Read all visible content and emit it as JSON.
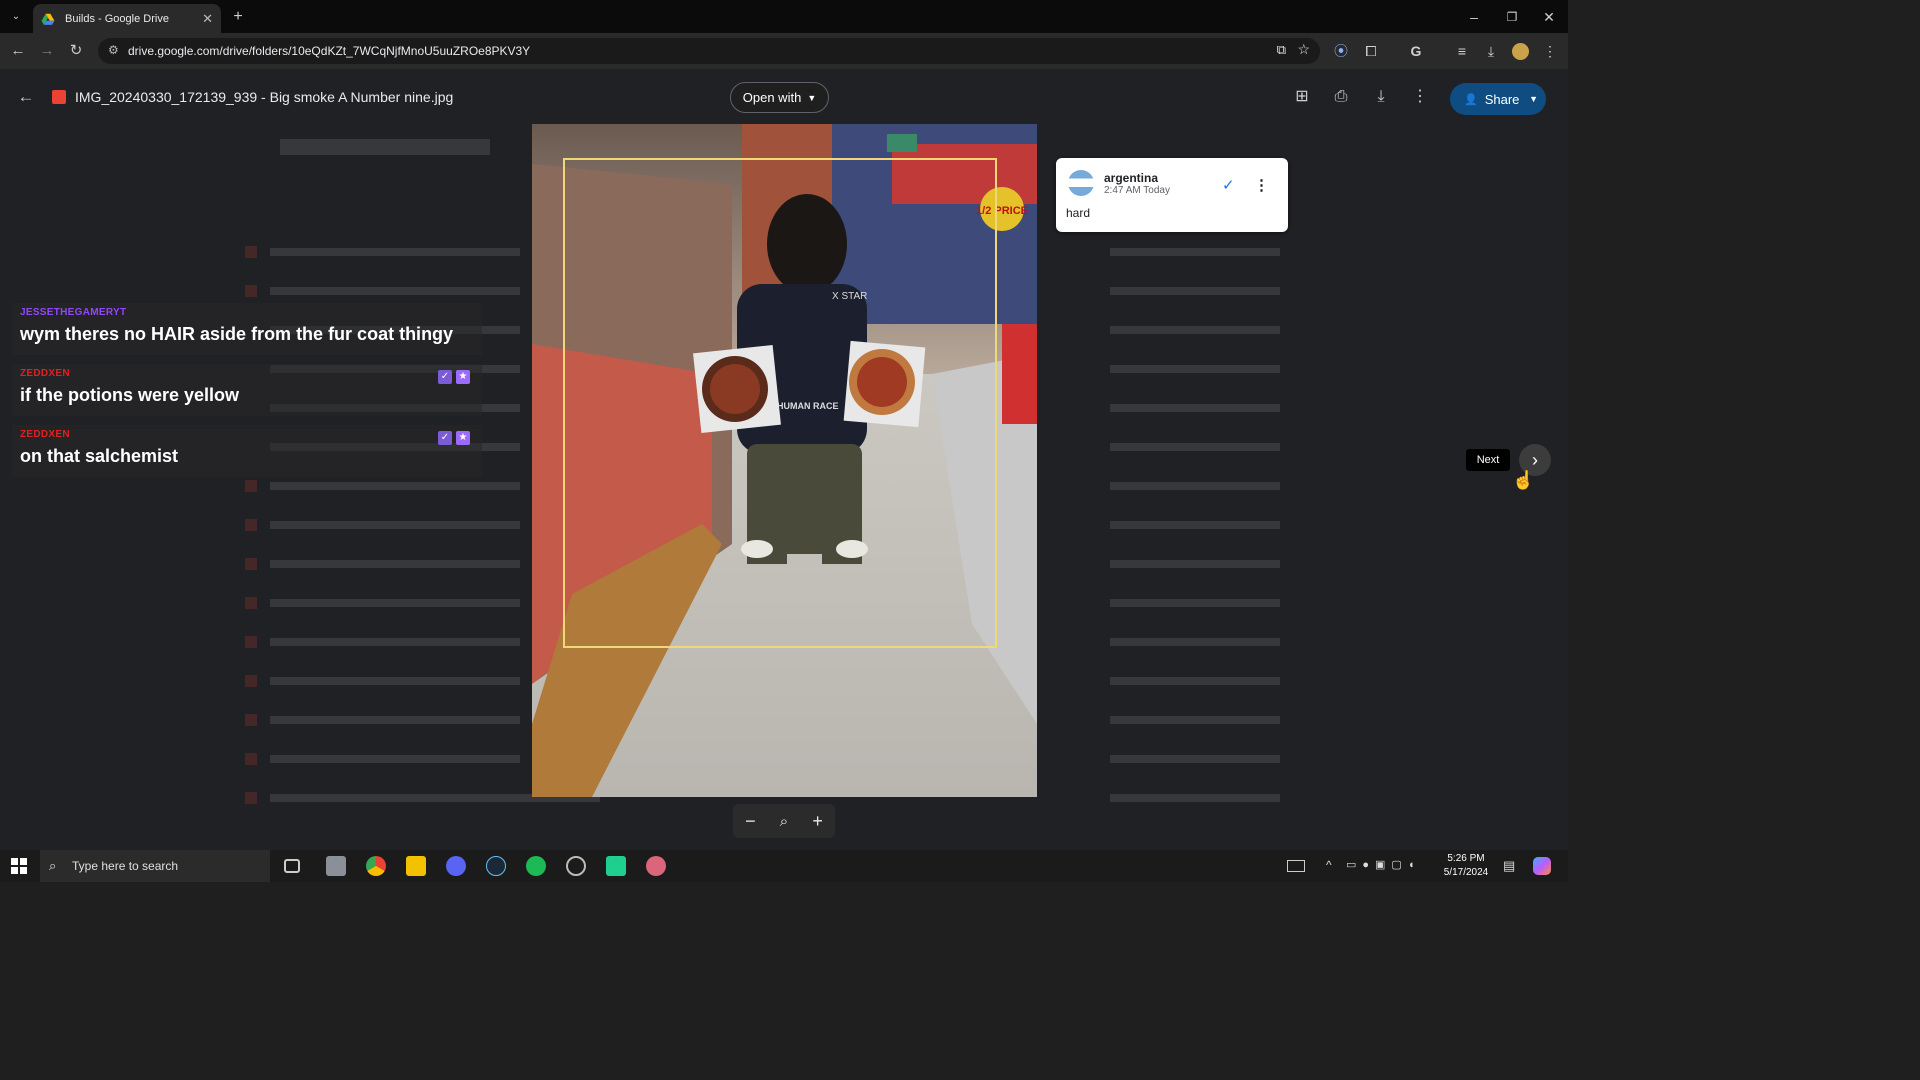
{
  "browser": {
    "tab_title": "Builds - Google Drive",
    "url": "drive.google.com/drive/folders/10eQdKZt_7WCqNjfMnoU5uuZROe8PKV3Y"
  },
  "viewer": {
    "file_name": "IMG_20240330_172139_939 - Big smoke A Number nine.jpg",
    "open_with_label": "Open with",
    "share_label": "Share"
  },
  "comment": {
    "author": "argentina",
    "time": "2:47 AM Today",
    "text": "hard"
  },
  "chat": [
    {
      "user": "JESSETHEGAMERYT",
      "user_color": "#9146ff",
      "message": "wym theres no HAIR aside from the fur coat thingy"
    },
    {
      "user": "ZEDDXEN",
      "user_color": "#e02020",
      "message": "if the potions were yellow"
    },
    {
      "user": "ZEDDXEN",
      "user_color": "#e02020",
      "message": "on that salchemist"
    }
  ],
  "shirt": {
    "brand": "X STAR",
    "text": "HUMAN RACE"
  },
  "store_sign": "1/2 PRICE",
  "next_label": "Next",
  "taskbar": {
    "search_placeholder": "Type here to search",
    "time": "5:26 PM",
    "date": "5/17/2024"
  }
}
